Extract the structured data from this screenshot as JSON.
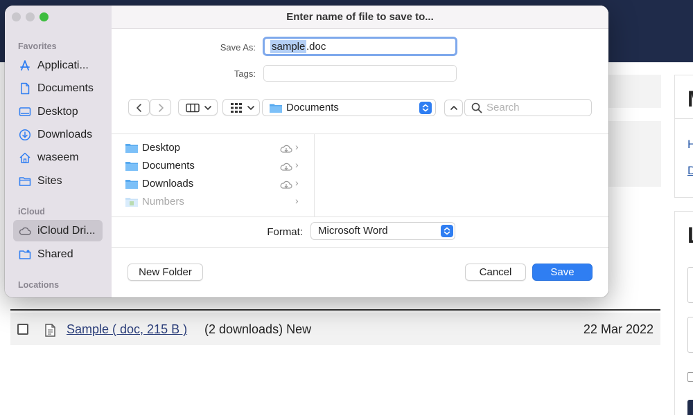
{
  "dialog": {
    "title": "Enter name of file to save to...",
    "save_as_label": "Save As:",
    "save_as_value_selected": "sample",
    "save_as_value_rest": ".doc",
    "tags_label": "Tags:",
    "tags_value": "",
    "location": "Documents",
    "search_placeholder": "Search",
    "format_label": "Format:",
    "format_value": "Microsoft Word",
    "new_folder_label": "New Folder",
    "cancel_label": "Cancel",
    "save_label": "Save"
  },
  "sidebar": {
    "favorites_header": "Favorites",
    "icloud_header": "iCloud",
    "locations_header": "Locations",
    "favorites": [
      {
        "label": "Applicati...",
        "icon": "applications-icon"
      },
      {
        "label": "Documents",
        "icon": "document-icon"
      },
      {
        "label": "Desktop",
        "icon": "desktop-icon"
      },
      {
        "label": "Downloads",
        "icon": "download-icon"
      },
      {
        "label": "waseem",
        "icon": "home-icon"
      },
      {
        "label": "Sites",
        "icon": "folder-icon"
      }
    ],
    "icloud": [
      {
        "label": "iCloud Dri...",
        "icon": "cloud-icon",
        "selected": true
      },
      {
        "label": "Shared",
        "icon": "shared-folder-icon"
      }
    ]
  },
  "browser": {
    "items": [
      {
        "label": "Desktop",
        "cloud": true,
        "dimmed": false
      },
      {
        "label": "Documents",
        "cloud": true,
        "dimmed": false
      },
      {
        "label": "Downloads",
        "cloud": true,
        "dimmed": false
      },
      {
        "label": "Numbers",
        "cloud": false,
        "dimmed": true
      }
    ]
  },
  "page": {
    "file_name": "Sample ( doc, 215 B )",
    "file_meta": "(2 downloads) New",
    "file_date": "22 Mar 2022",
    "right_panel_letter_1": "M",
    "right_panel_link_1": "H",
    "right_panel_link_2": "D",
    "right_panel_letter_2": "L"
  },
  "colors": {
    "accent": "#2f7ef2",
    "sidebar_bg": "#e5e1e8",
    "header_bg": "#1f2b4a",
    "selection": "#b4cff5",
    "close": "#c9c7cc",
    "zoom": "#3dbd3f"
  }
}
